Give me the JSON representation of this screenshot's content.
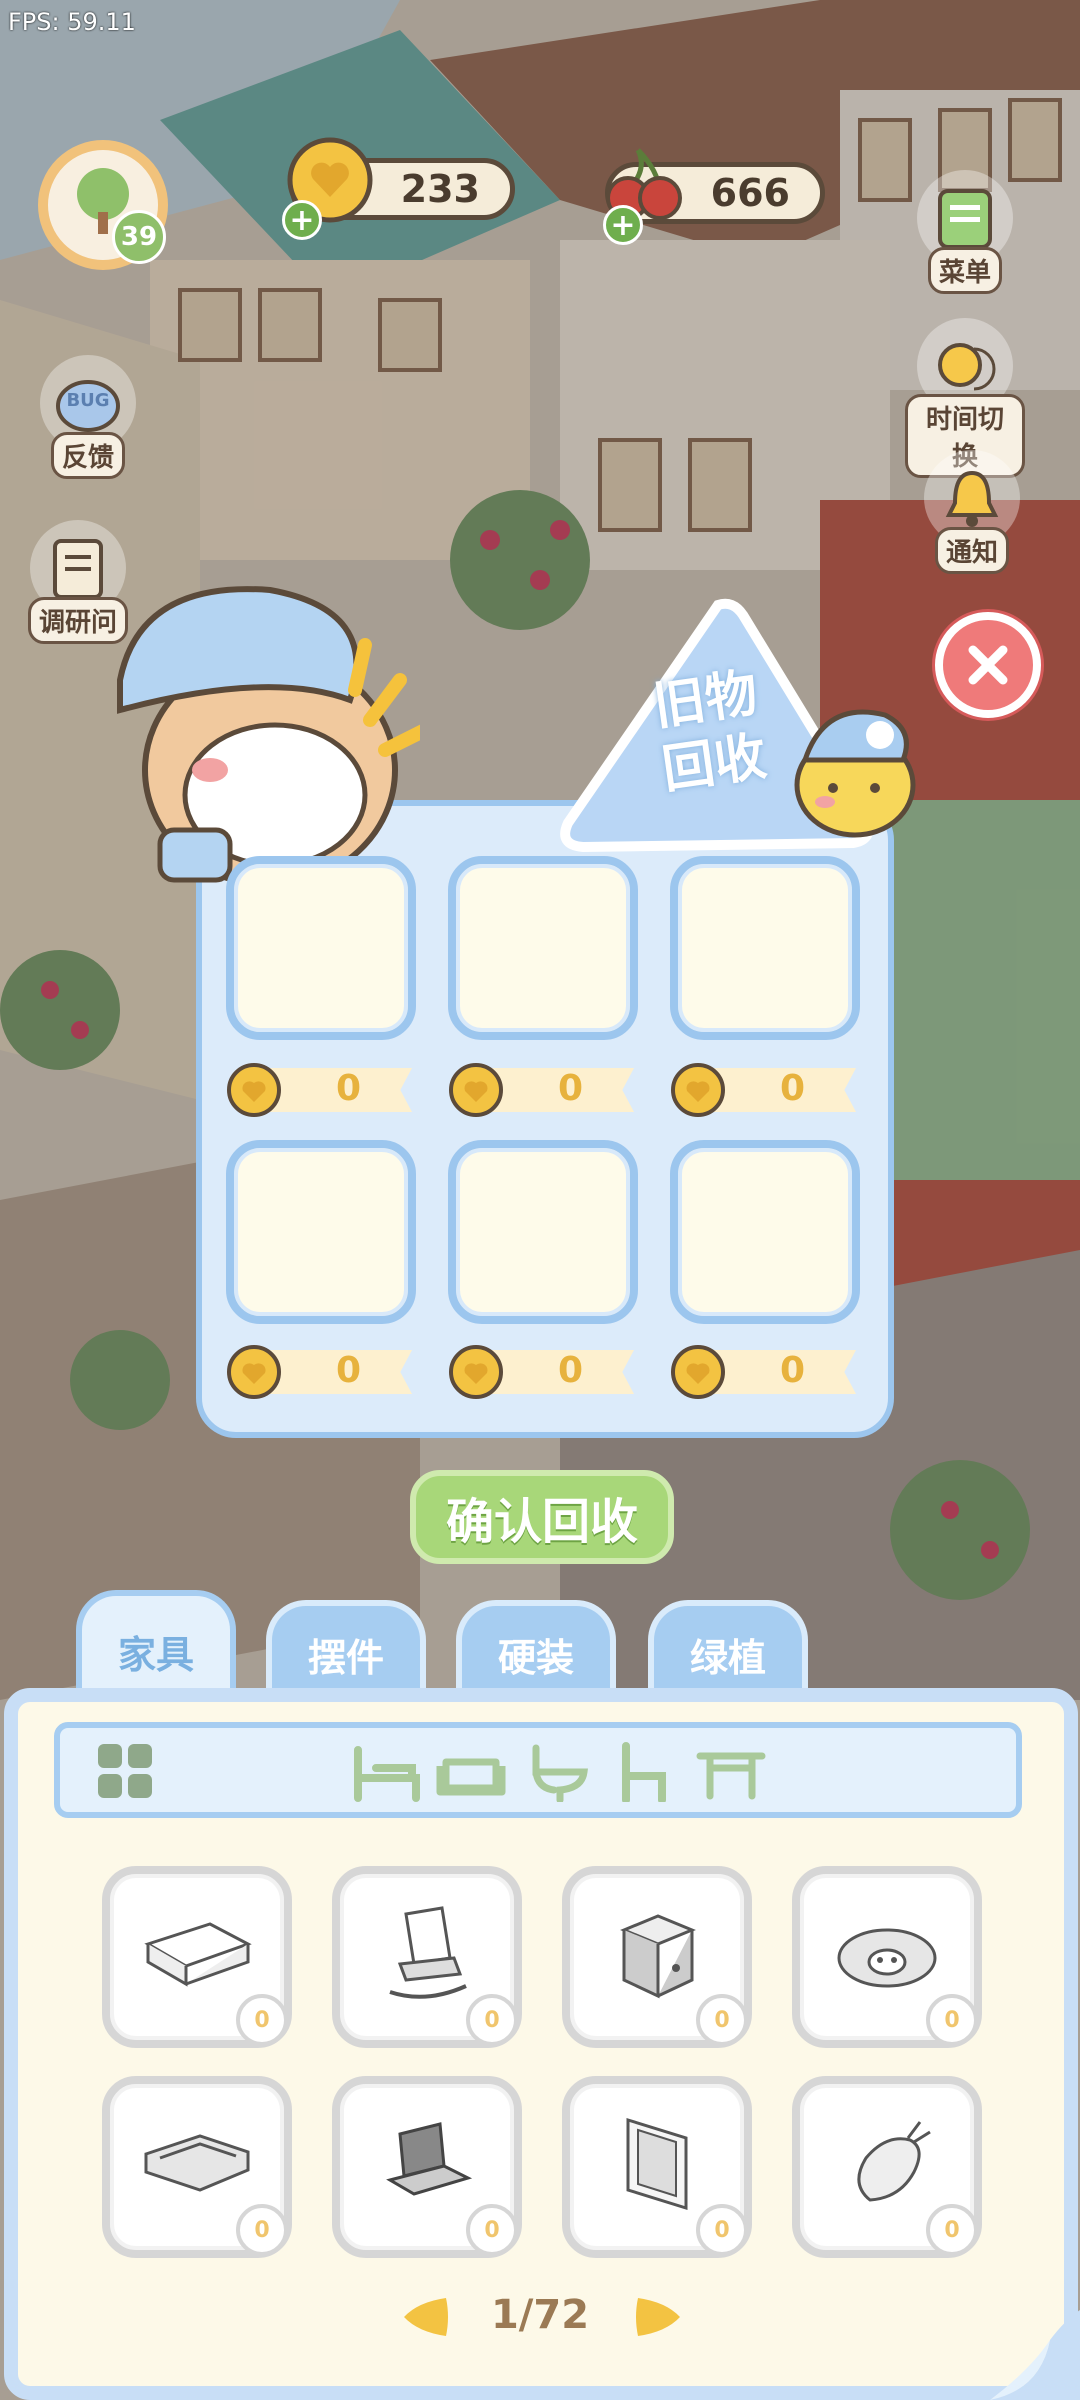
{
  "hud": {
    "fps": "FPS: 59.11",
    "level": "39",
    "coins": "233",
    "cherries": "666",
    "side_buttons": {
      "menu": "菜单",
      "time_switch": "时间切换",
      "notice": "通知",
      "feedback": "反馈",
      "survey": "调研问",
      "bug_label": "BUG"
    }
  },
  "recycle": {
    "title_line1": "旧物",
    "title_line2": "回收",
    "slots": [
      {
        "price": "0"
      },
      {
        "price": "0"
      },
      {
        "price": "0"
      },
      {
        "price": "0"
      },
      {
        "price": "0"
      },
      {
        "price": "0"
      }
    ],
    "confirm_label": "确认回收"
  },
  "inventory": {
    "tabs": [
      {
        "label": "家具",
        "active": true
      },
      {
        "label": "摆件",
        "active": false
      },
      {
        "label": "硬装",
        "active": false
      },
      {
        "label": "绿植",
        "active": false
      }
    ],
    "filter_icons": [
      "grid-icon",
      "bed-icon",
      "sofa-icon",
      "toilet-icon",
      "chair-icon",
      "table-icon"
    ],
    "items": [
      {
        "icon": "desk-icon",
        "count": "0"
      },
      {
        "icon": "rocking-chair-icon",
        "count": "0"
      },
      {
        "icon": "nightstand-icon",
        "count": "0"
      },
      {
        "icon": "sheep-rug-icon",
        "count": "0"
      },
      {
        "icon": "corner-sofa-icon",
        "count": "0"
      },
      {
        "icon": "laptop-icon",
        "count": "0"
      },
      {
        "icon": "window-icon",
        "count": "0"
      },
      {
        "icon": "carrot-rug-icon",
        "count": "0"
      }
    ],
    "page": "1/72"
  },
  "colors": {
    "panel_blue": "#9cc6ee",
    "confirm_green": "#a8d779",
    "close_red": "#ef7a7a",
    "coin_gold": "#f3c342"
  }
}
